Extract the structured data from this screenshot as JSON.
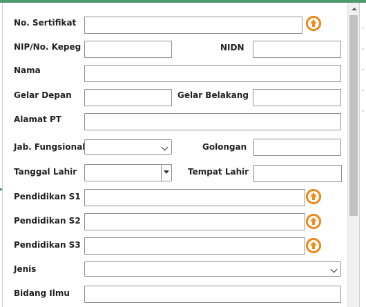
{
  "form": {
    "no_sertifikat": {
      "label": "No. Sertifikat",
      "value": ""
    },
    "nip": {
      "label": "NIP/No. Kepeg",
      "value": ""
    },
    "nidn": {
      "label": "NIDN",
      "value": ""
    },
    "nama": {
      "label": "Nama",
      "value": ""
    },
    "gelar_depan": {
      "label": "Gelar Depan",
      "value": ""
    },
    "gelar_belakang": {
      "label": "Gelar Belakang",
      "value": ""
    },
    "alamat_pt": {
      "label": "Alamat PT",
      "value": ""
    },
    "jab_fungsional": {
      "label": "Jab. Fungsional",
      "selected": ""
    },
    "golongan": {
      "label": "Golongan",
      "value": ""
    },
    "tanggal_lahir": {
      "label": "Tanggal Lahir",
      "value": ""
    },
    "tempat_lahir": {
      "label": "Tempat Lahir",
      "value": ""
    },
    "pendidikan_s1": {
      "label": "Pendidikan S1",
      "value": ""
    },
    "pendidikan_s2": {
      "label": "Pendidikan S2",
      "value": ""
    },
    "pendidikan_s3": {
      "label": "Pendidikan S3",
      "value": ""
    },
    "jenis": {
      "label": "Jenis",
      "selected": ""
    },
    "bidang_ilmu": {
      "label": "Bidang Ilmu",
      "value": ""
    }
  },
  "icons": {
    "upload": "upload-arrow-icon",
    "dropdown": "chevron-down-icon",
    "date": "triangle-down-icon"
  },
  "colors": {
    "accent_orange": "#f28c1b",
    "field_border": "#8f8f8f",
    "label_text": "#222222",
    "window_edge_green": "#2e8b57"
  }
}
